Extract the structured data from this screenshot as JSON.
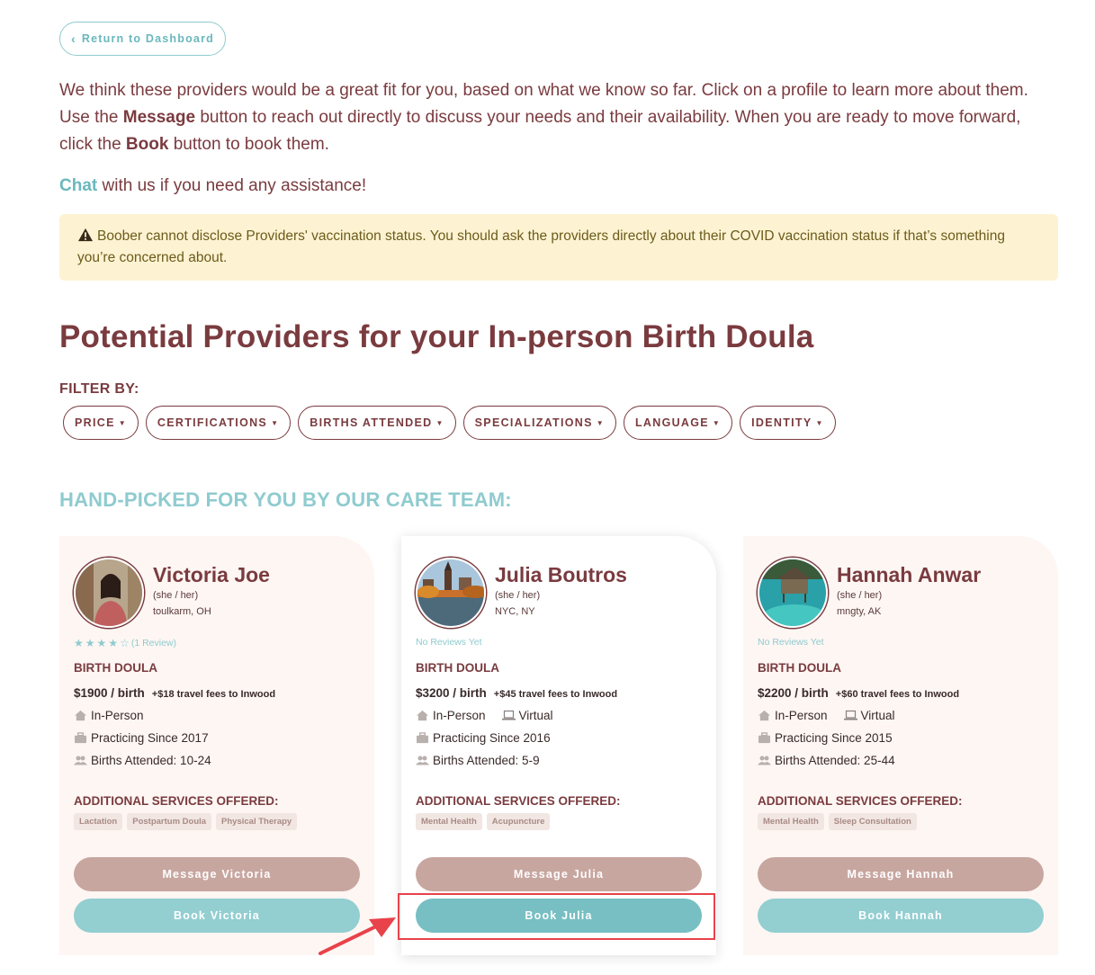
{
  "nav": {
    "return_label": "Return to Dashboard"
  },
  "intro": {
    "p1_a": "We think these providers would be a great fit for you, based on what we know so far. Click on a profile to learn more about them. Use the ",
    "message_word": "Message",
    "p1_b": " button to reach out directly to discuss your needs and their availability. When you are ready to move forward, click the ",
    "book_word": "Book",
    "p1_c": " button to book them.",
    "chat_link": "Chat",
    "chat_rest": " with us if you need any assistance!"
  },
  "alert": {
    "text": "Boober cannot disclose Providers' vaccination status. You should ask the providers directly about their COVID vaccination status if that’s something you’re concerned about."
  },
  "page_title": "Potential Providers for your In-person Birth Doula",
  "filters": {
    "label": "FILTER BY:",
    "items": [
      "PRICE",
      "CERTIFICATIONS",
      "BIRTHS ATTENDED",
      "SPECIALIZATIONS",
      "LANGUAGE",
      "IDENTITY"
    ]
  },
  "section_title": "HAND-PICKED FOR YOU BY OUR CARE TEAM:",
  "providers": [
    {
      "name": "Victoria Joe",
      "pronouns": "(she / her)",
      "location": "toulkarm, OH",
      "rating": 4,
      "reviews": "(1 Review)",
      "role": "BIRTH DOULA",
      "price": "$1900 / birth",
      "travel": "+$18 travel fees to Inwood",
      "mode1": "In-Person",
      "mode2": "",
      "practicing": "Practicing Since 2017",
      "births": "Births Attended: 10-24",
      "addl_label": "ADDITIONAL SERVICES OFFERED:",
      "services": [
        "Lactation",
        "Postpartum Doula",
        "Physical Therapy"
      ],
      "message_label": "Message Victoria",
      "book_label": "Book Victoria"
    },
    {
      "name": "Julia Boutros",
      "pronouns": "(she / her)",
      "location": "NYC, NY",
      "rating": 0,
      "reviews": "No Reviews Yet",
      "role": "BIRTH DOULA",
      "price": "$3200 / birth",
      "travel": "+$45 travel fees to Inwood",
      "mode1": "In-Person",
      "mode2": "Virtual",
      "practicing": "Practicing Since 2016",
      "births": "Births Attended: 5-9",
      "addl_label": "ADDITIONAL SERVICES OFFERED:",
      "services": [
        "Mental Health",
        "Acupuncture"
      ],
      "message_label": "Message Julia",
      "book_label": "Book Julia"
    },
    {
      "name": "Hannah Anwar",
      "pronouns": "(she / her)",
      "location": "mngty, AK",
      "rating": 0,
      "reviews": "No Reviews Yet",
      "role": "BIRTH DOULA",
      "price": "$2200 / birth",
      "travel": "+$60 travel fees to Inwood",
      "mode1": "In-Person",
      "mode2": "Virtual",
      "practicing": "Practicing Since 2015",
      "births": "Births Attended: 25-44",
      "addl_label": "ADDITIONAL SERVICES OFFERED:",
      "services": [
        "Mental Health",
        "Sleep Consultation"
      ],
      "message_label": "Message Hannah",
      "book_label": "Book Hannah"
    }
  ],
  "colors": {
    "maroon": "#7a3b3f",
    "teal": "#8fcbcf",
    "alert_bg": "#fdf3d2",
    "highlight": "#e8424a"
  }
}
